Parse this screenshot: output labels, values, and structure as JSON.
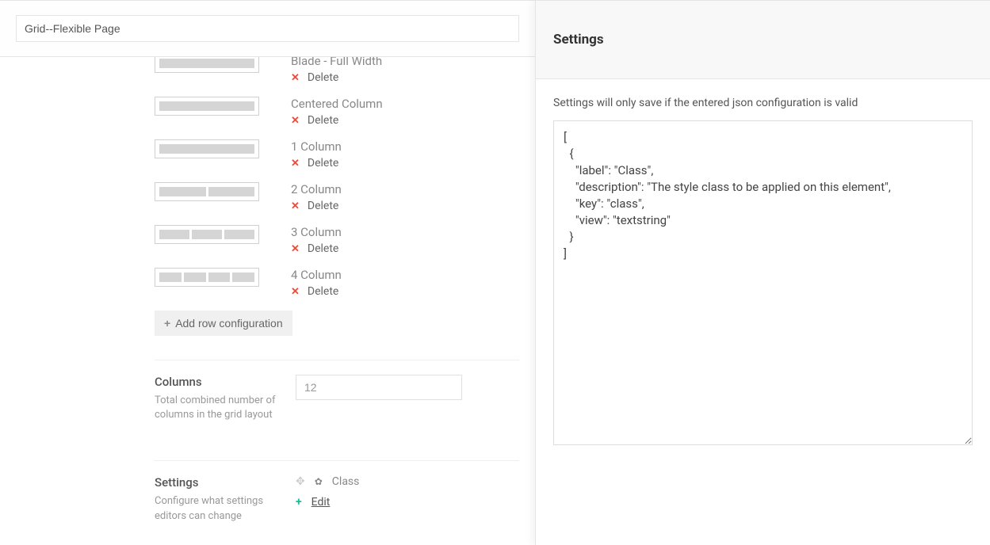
{
  "header": {
    "title_value": "Grid--Flexible Page"
  },
  "rows": [
    {
      "label": "Blade - Full Width",
      "cells": 1,
      "delete": "Delete"
    },
    {
      "label": "Centered Column",
      "cells": 1,
      "delete": "Delete"
    },
    {
      "label": "1 Column",
      "cells": 1,
      "delete": "Delete"
    },
    {
      "label": "2 Column",
      "cells": 2,
      "delete": "Delete"
    },
    {
      "label": "3 Column",
      "cells": 3,
      "delete": "Delete"
    },
    {
      "label": "4 Column",
      "cells": 4,
      "delete": "Delete"
    }
  ],
  "add_row_label": "Add row configuration",
  "columns_section": {
    "title": "Columns",
    "desc": "Total combined number of columns in the grid layout",
    "value": "12"
  },
  "settings_section": {
    "title": "Settings",
    "desc": "Configure what settings editors can change",
    "item_label": "Class",
    "edit_label": "Edit"
  },
  "right_panel": {
    "title": "Settings",
    "hint": "Settings will only save if the entered json configuration is valid",
    "json_value": "[\n  {\n    \"label\": \"Class\",\n    \"description\": \"The style class to be applied on this element\",\n    \"key\": \"class\",\n    \"view\": \"textstring\"\n  }\n]"
  }
}
